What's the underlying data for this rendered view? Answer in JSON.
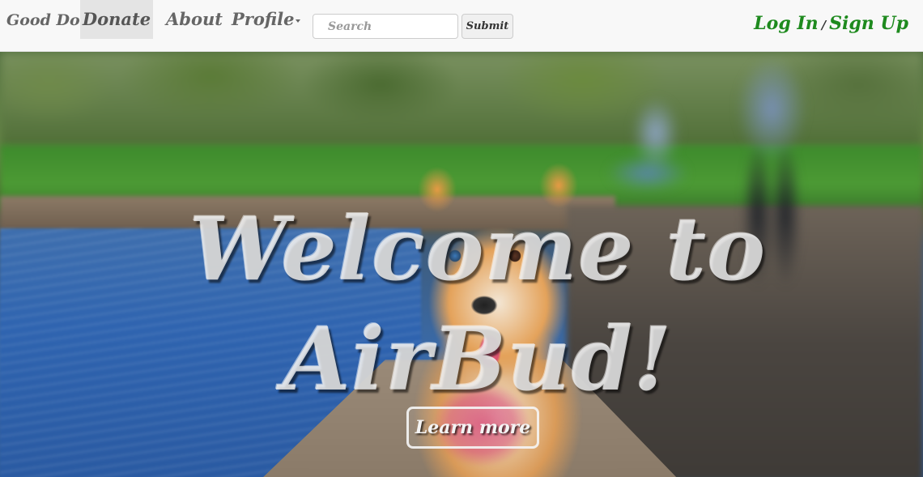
{
  "navbar": {
    "brand": "Good Dog!",
    "items": [
      {
        "label": "Donate",
        "active": true
      },
      {
        "label": "About",
        "active": false
      },
      {
        "label": "Profile",
        "active": false,
        "dropdown": true
      }
    ],
    "search": {
      "placeholder": "Search",
      "value": ""
    },
    "submit_label": "Submit",
    "auth": {
      "login_label": "Log In",
      "separator": "/",
      "signup_label": "Sign Up"
    }
  },
  "hero": {
    "title_line1": "Welcome to",
    "title_line2": "AirBud!",
    "cta_label": "Learn more"
  },
  "colors": {
    "auth_link": "#1e8a1e",
    "navbar_bg": "#f8f8f8",
    "active_item_bg": "#e4e4e4"
  }
}
